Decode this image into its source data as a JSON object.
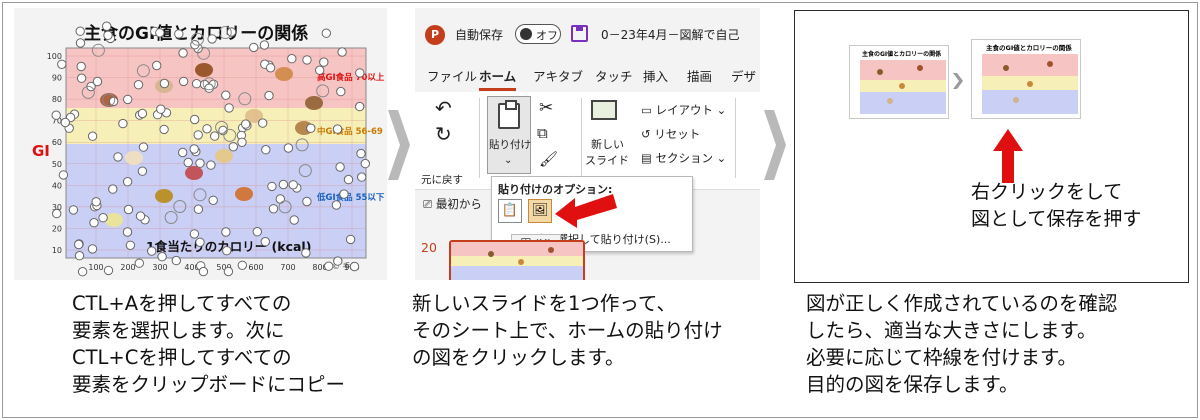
{
  "panel1": {
    "chart": {
      "title": "主食のGI値とカロリーの関係",
      "ylabel": "GI",
      "xlabel": "1食当たりのカロリー (kcal)",
      "yticks": [
        "100",
        "90",
        "80",
        "70",
        "60",
        "50",
        "40",
        "30",
        "20",
        "10"
      ],
      "xticks": [
        "100",
        "200",
        "300",
        "400",
        "500",
        "600",
        "700",
        "800",
        "900"
      ],
      "band_labels": [
        "高GI食品 70以上",
        "中GI食品 56-69",
        "低GI食品 55以下"
      ],
      "copyright": "© 手技"
    },
    "caption": [
      "CTL+Aを押してすべての",
      "要素を選択します。次に",
      "CTL+Cを押してすべての",
      "要素をクリップボードにコピー"
    ]
  },
  "panel2": {
    "app_logo": "P",
    "autosave_label": "自動保存",
    "autosave_toggle": "オフ",
    "doc_title": "0－23年4月－図解で自己",
    "tabs": [
      "ファイル",
      "ホーム",
      "アキタブ",
      "タッチ",
      "挿入",
      "描画",
      "デザ"
    ],
    "active_tab": "ホーム",
    "ribbon": {
      "paste_label": "貼り付け",
      "restore_label": "元に戻す",
      "new_slide_label": [
        "新しい",
        "スライド"
      ],
      "layout_label": "レイアウト",
      "reset_label": "リセット",
      "section_label": "セクション",
      "from_start_label": "最初から"
    },
    "paste_options": {
      "title": "貼り付けのオプション:",
      "special_item": "形式を選択して貼り付け(S)...",
      "tooltip": "図 (U)"
    },
    "slide_number": "20",
    "caption": [
      "新しいスライドを1つ作って、",
      "そのシート上で、ホームの貼り付け",
      "の図をクリックします。"
    ]
  },
  "panel3": {
    "mini_title": "主食のGI値とカロリーの関係",
    "note": [
      "右クリックをして",
      "図として保存を押す"
    ],
    "caption": [
      "図が正しく作成されているのを確認",
      "したら、適当な大きさにします。",
      "必要に応じて枠線を付けます。",
      "目的の図を保存します。"
    ]
  },
  "colors": {
    "high_band": "#f7c4c4",
    "mid_band": "#f6efb8",
    "low_band": "#c9cff5",
    "accent_red": "#e01010",
    "ppt_orange": "#c43e1c"
  }
}
